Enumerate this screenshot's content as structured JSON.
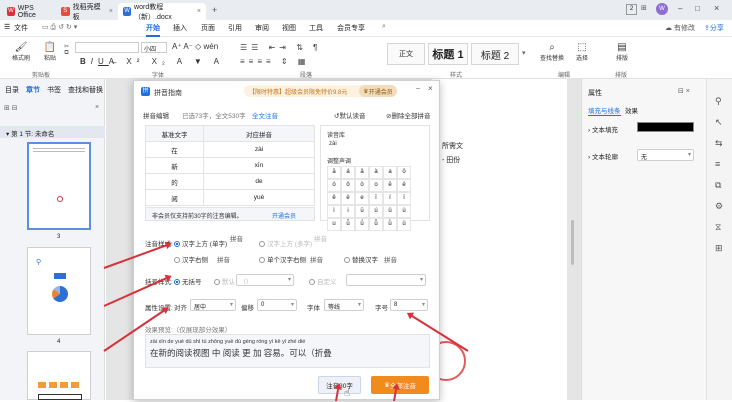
{
  "titlebar": {
    "tabs": [
      {
        "label": "WPS Office"
      },
      {
        "label": "找稻壳模板"
      },
      {
        "label": "word教程（新）.docx"
      }
    ],
    "window_num": "2",
    "user_initial": "W"
  },
  "menubar": {
    "file": "文件",
    "items": [
      "开始",
      "插入",
      "页面",
      "引用",
      "审阅",
      "视图",
      "工具",
      "会员专享"
    ],
    "right": {
      "cloud": "有修改",
      "share": "分享"
    }
  },
  "ribbon": {
    "format_brush": "格式刷",
    "paste": "粘贴",
    "groups": {
      "clipboard": "剪贴板",
      "font": "字体",
      "paragraph": "段落",
      "style": "样式",
      "edit": "编辑",
      "layout": "排版"
    },
    "font_size": "小四",
    "styles": [
      "正文",
      "标题 1",
      "标题 2"
    ],
    "find_replace": "查找替换",
    "select": "选择",
    "layout_btn": "排版"
  },
  "leftpanel": {
    "tabs": [
      "目录",
      "章节",
      "书签",
      "查找和替换"
    ],
    "section": "第 1 节: 未命名",
    "pages": [
      "3",
      "4"
    ]
  },
  "rightpanel": {
    "title": "属性",
    "tabs": [
      "填充与线条",
      "效果"
    ],
    "fill": "文本填充",
    "outline": "文本轮廓",
    "outline_value": "无"
  },
  "doc": {
    "snippet1": "所需文",
    "snippet2": "- 田份"
  },
  "dialog": {
    "title": "拼音指南",
    "promo": "【限时特惠】超级会员限免特价9.8元",
    "promo_btn": "开通会员",
    "edit_label": "拼音编辑",
    "count": "已选73字，全文530字",
    "full_text": "全文注音",
    "tools": {
      "read": "默认读音",
      "delete": "删除全部拼音"
    },
    "table_headers": [
      "基准文字",
      "对应拼音"
    ],
    "rows": [
      {
        "char": "在",
        "pinyin": "zài"
      },
      {
        "char": "新",
        "pinyin": "xīn"
      },
      {
        "char": "的",
        "pinyin": "de"
      },
      {
        "char": "阅",
        "pinyin": "yuè"
      }
    ],
    "notice": "非会员仅支持前30字的注音编辑。",
    "notice_link": "开通会员",
    "reading_label": "读音库",
    "reading_value": "zài",
    "tone_label": "调整声调",
    "tones": [
      "ā",
      "á",
      "ǎ",
      "à",
      "a",
      "ō",
      "ó",
      "ǒ",
      "ò",
      "o",
      "ē",
      "é",
      "ě",
      "è",
      "e",
      "ī",
      "í",
      "ǐ",
      "ì",
      "i",
      "ū",
      "ú",
      "ǔ",
      "ù",
      "u",
      "ǖ",
      "ǘ",
      "ǚ",
      "ǜ",
      "ü"
    ],
    "annot_label": "注音样式:",
    "annot": {
      "opt1": "汉字上方 (单字)",
      "opt2": "汉字上方 (多字)",
      "opt3": "汉字右侧",
      "opt4": "单个汉字右侧",
      "opt5": "替换汉字",
      "s1": "拼音",
      "s2": "拼音",
      "s3": "拼音",
      "s4": "拼音",
      "s5": "拼音"
    },
    "symbol_label": "括号样式:",
    "symbol": {
      "none": "无括号",
      "default": "默认",
      "paren": "（）",
      "custom": "自定义"
    },
    "attr_label": "属性设置:",
    "attr": {
      "align_label": "对齐",
      "align": "居中",
      "offset_label": "偏移",
      "offset": "0",
      "font_label": "字体",
      "font": "等线",
      "size_label": "字号",
      "size": "8"
    },
    "preview_label": "效果预览:（仅展现部分效果）",
    "preview_pinyin": "zài xīn de yuè dú shì tú zhōng yuè dú gèng róng yì   kě   yǐ zhé dié",
    "preview_text": "在新的阅读视图 中 阅读 更 加 容易。可以（折叠",
    "btn_annotate": "注音30字",
    "btn_all": "全部注音"
  },
  "colors": {
    "accent": "#1f6fde",
    "orange": "#f28b1d",
    "arrow": "#d9303a"
  }
}
